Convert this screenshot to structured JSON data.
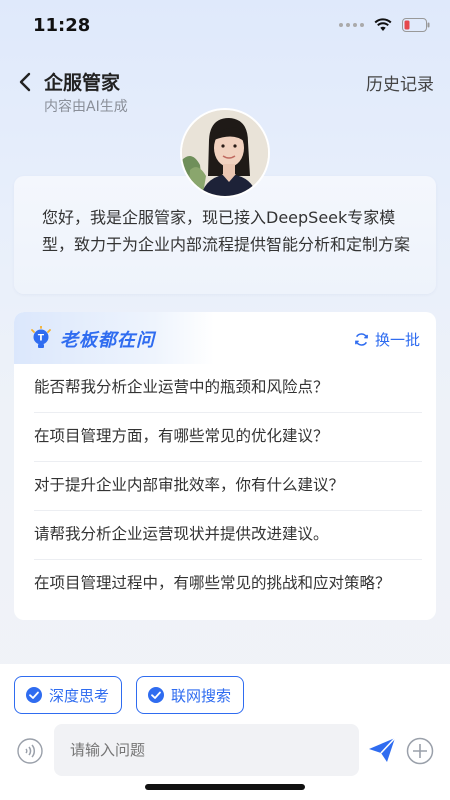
{
  "status": {
    "time": "11:28"
  },
  "nav": {
    "title": "企服管家",
    "subtitle": "内容由AI生成",
    "history": "历史记录"
  },
  "intro": {
    "text": "您好，我是企服管家，现已接入DeepSeek专家模型，致力于为企业内部流程提供智能分析和定制方案"
  },
  "qa": {
    "title": "老板都在问",
    "refresh": "换一批",
    "items": [
      "能否帮我分析企业运营中的瓶颈和风险点？",
      "在项目管理方面，有哪些常见的优化建议？",
      "对于提升企业内部审批效率，你有什么建议？",
      "请帮我分析企业运营现状并提供改进建议。",
      "在项目管理过程中，有哪些常见的挑战和应对策略？"
    ]
  },
  "chips": {
    "deep_think": "深度思考",
    "web_search": "联网搜索"
  },
  "input": {
    "placeholder": "请输入问题"
  },
  "colors": {
    "accent": "#2f6cf0",
    "battery_low": "#e5484d"
  },
  "icons": [
    "back-icon",
    "wifi-icon",
    "battery-icon",
    "bulb-icon",
    "refresh-icon",
    "check-icon",
    "voice-icon",
    "send-icon",
    "plus-icon"
  ]
}
